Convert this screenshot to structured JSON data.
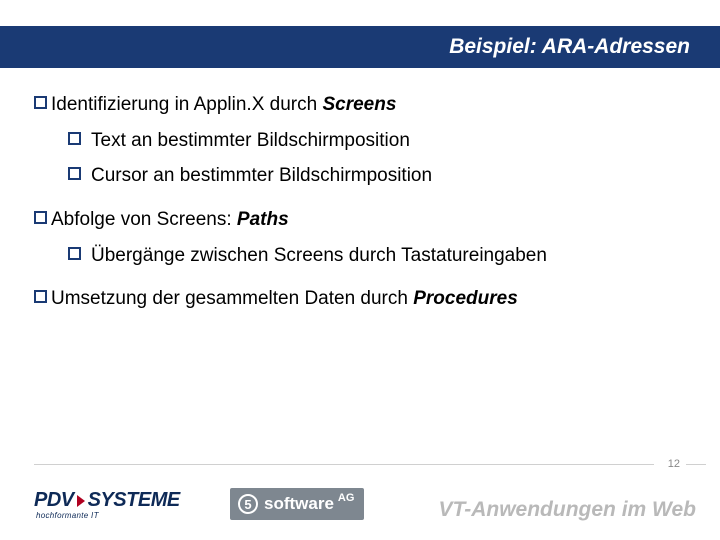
{
  "title": "Beispiel: ARA-Adressen",
  "bullets": {
    "b1_pre": "Identifizierung in Applin.X durch ",
    "b1_em": "Screens",
    "b1a": "Text an bestimmter Bildschirmposition",
    "b1b": "Cursor an bestimmter Bildschirmposition",
    "b2_pre": "Abfolge von Screens: ",
    "b2_em": "Paths",
    "b2a": "Übergänge zwischen Screens durch Tastatureingaben",
    "b3_pre": "Umsetzung der gesammelten Daten durch ",
    "b3_em": "Procedures"
  },
  "page_number": "12",
  "footer_subtitle": "VT-Anwendungen im Web",
  "logos": {
    "pdv_part1": "PDV",
    "pdv_part2": "SYSTEME",
    "pdv_sub": "hochformante IT",
    "sag_symbol": "5",
    "sag_text": "software",
    "sag_suffix": "AG"
  }
}
